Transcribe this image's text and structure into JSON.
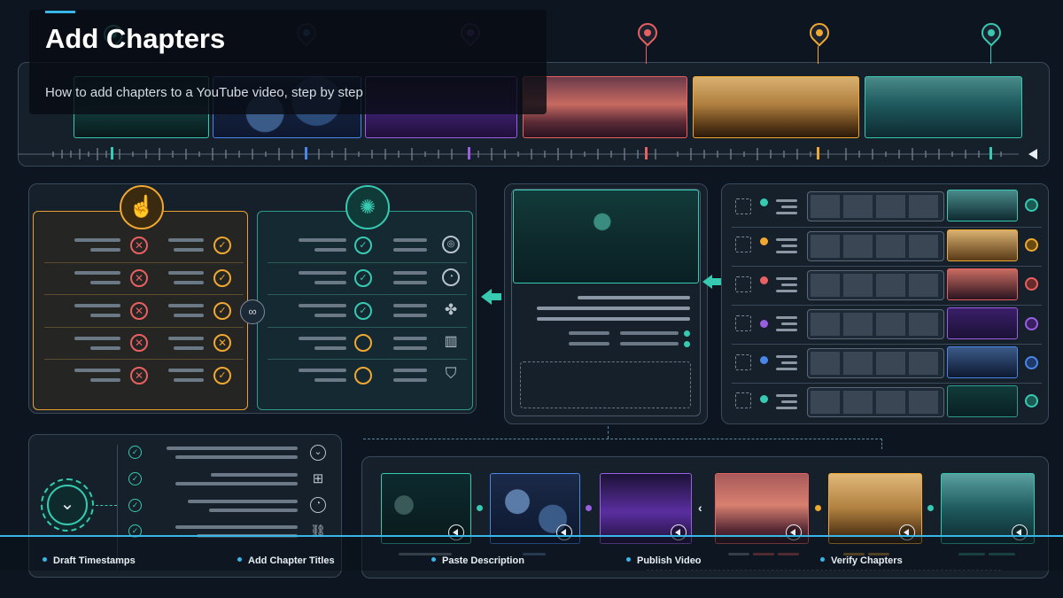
{
  "header": {
    "title": "Add Chapters",
    "subtitle": "How to add chapters to a YouTube video, step by step"
  },
  "colors": {
    "teal": "#38c9b2",
    "blue": "#4a86e8",
    "purple": "#9a5ee0",
    "red": "#e86060",
    "orange": "#f0a830",
    "accent_line": "#38b6e8"
  },
  "timeline": {
    "marker_colors": [
      "teal",
      "blue",
      "purple",
      "red",
      "orange",
      "teal"
    ],
    "end_arrow_icon": "play-reverse-icon"
  },
  "comparison": {
    "left_icon": "hand-pointer-icon",
    "right_icon": "brain-icon",
    "center_icon": "link-icon",
    "left_marks": [
      "x-icon",
      "check-icon"
    ],
    "right_side_icons": [
      "target-icon",
      "clock-icon",
      "puzzle-icon",
      "bar-chart-icon",
      "shield-icon"
    ]
  },
  "steps": [
    {
      "label": "Draft Timestamps"
    },
    {
      "label": "Add Chapter Titles"
    },
    {
      "label": "Paste Description"
    },
    {
      "label": "Publish Video"
    },
    {
      "label": "Verify Chapters"
    }
  ],
  "bottom_left_icons": [
    "chevron-down-icon",
    "hierarchy-icon",
    "clock-icon",
    "link-icon"
  ]
}
